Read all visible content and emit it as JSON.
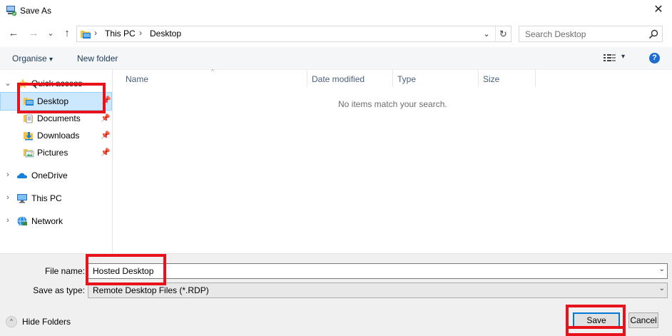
{
  "window": {
    "title": "Save As",
    "close_glyph": "✕"
  },
  "nav": {
    "back_glyph": "←",
    "forward_glyph": "→",
    "recent_glyph": "⌄",
    "up_glyph": "↑",
    "breadcrumb": [
      "This PC",
      "Desktop"
    ],
    "separator": "›",
    "address_dropdown_glyph": "⌄",
    "refresh_glyph": "↻",
    "search_placeholder": "Search Desktop"
  },
  "toolbar": {
    "organise_label": "Organise",
    "organise_arrow": "▾",
    "new_folder_label": "New folder",
    "view_dropdown_glyph": "▾",
    "help_glyph": "?"
  },
  "sidebar": {
    "quick_access": {
      "label": "Quick access",
      "expand_glyph": "⌄"
    },
    "quick_items": [
      {
        "label": "Desktop",
        "pin": "📌",
        "icon": "desktop-folder-icon"
      },
      {
        "label": "Documents",
        "pin": "📌",
        "icon": "documents-folder-icon"
      },
      {
        "label": "Downloads",
        "pin": "📌",
        "icon": "downloads-folder-icon"
      },
      {
        "label": "Pictures",
        "pin": "📌",
        "icon": "pictures-folder-icon"
      }
    ],
    "roots": [
      {
        "label": "OneDrive",
        "expand_glyph": "›",
        "icon": "onedrive-icon"
      },
      {
        "label": "This PC",
        "expand_glyph": "›",
        "icon": "computer-icon"
      },
      {
        "label": "Network",
        "expand_glyph": "›",
        "icon": "network-icon"
      }
    ]
  },
  "file_list": {
    "columns": [
      "Name",
      "Date modified",
      "Type",
      "Size"
    ],
    "sort_glyph": "^",
    "empty_message": "No items match your search."
  },
  "form": {
    "file_name_label": "File name:",
    "file_name_value": "Hosted Desktop",
    "save_type_label": "Save as type:",
    "save_type_value": "Remote Desktop Files (*.RDP)",
    "dropdown_glyph": "⌄"
  },
  "footer": {
    "hide_folders_label": "Hide Folders",
    "hide_folders_glyph": "^",
    "save_label": "Save",
    "cancel_label": "Cancel"
  },
  "colors": {
    "highlight": "#e8121b",
    "selection_bg": "#cce8ff",
    "link_text": "#1e395b"
  }
}
